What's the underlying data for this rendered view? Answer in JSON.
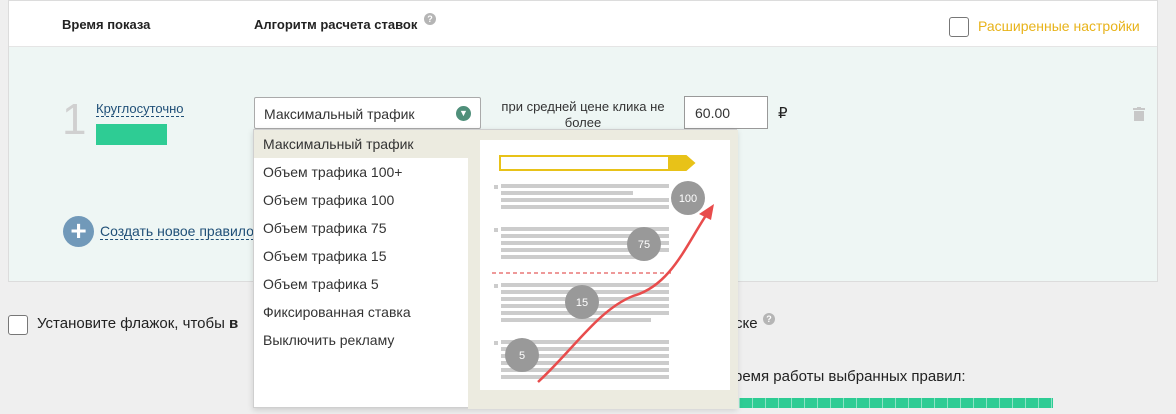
{
  "header": {
    "show_time_label": "Время показа",
    "algorithm_label": "Алгоритм расчета ставок",
    "help_glyph": "?",
    "advanced_label": "Расширенные настройки"
  },
  "rule": {
    "number": "1",
    "schedule_link": "Круглосуточно",
    "algorithm_value": "Максимальный трафик",
    "price_label": "при средней цене клика не более",
    "price_value": "60.00",
    "currency": "₽"
  },
  "create_rule_link": "Создать новое правило",
  "dropdown": {
    "options": [
      "Максимальный трафик",
      "Объем трафика 100+",
      "Объем трафика 100",
      "Объем трафика 75",
      "Объем трафика 15",
      "Объем трафика 5",
      "Фиксированная ставка",
      "Выключить рекламу"
    ],
    "selected_index": 0
  },
  "preview_markers": [
    "100",
    "75",
    "15",
    "5"
  ],
  "flag": {
    "label_start": "Установите флажок, чтобы ",
    "label_bold": "в",
    "label_tail": "ске"
  },
  "worktime_label": "ремя работы выбранных правил:",
  "colors": {
    "accent_green": "#2ecc94",
    "advanced_yellow": "#e8b31a",
    "link_blue": "#1f4f77",
    "arrow_red": "#e84c4c"
  }
}
